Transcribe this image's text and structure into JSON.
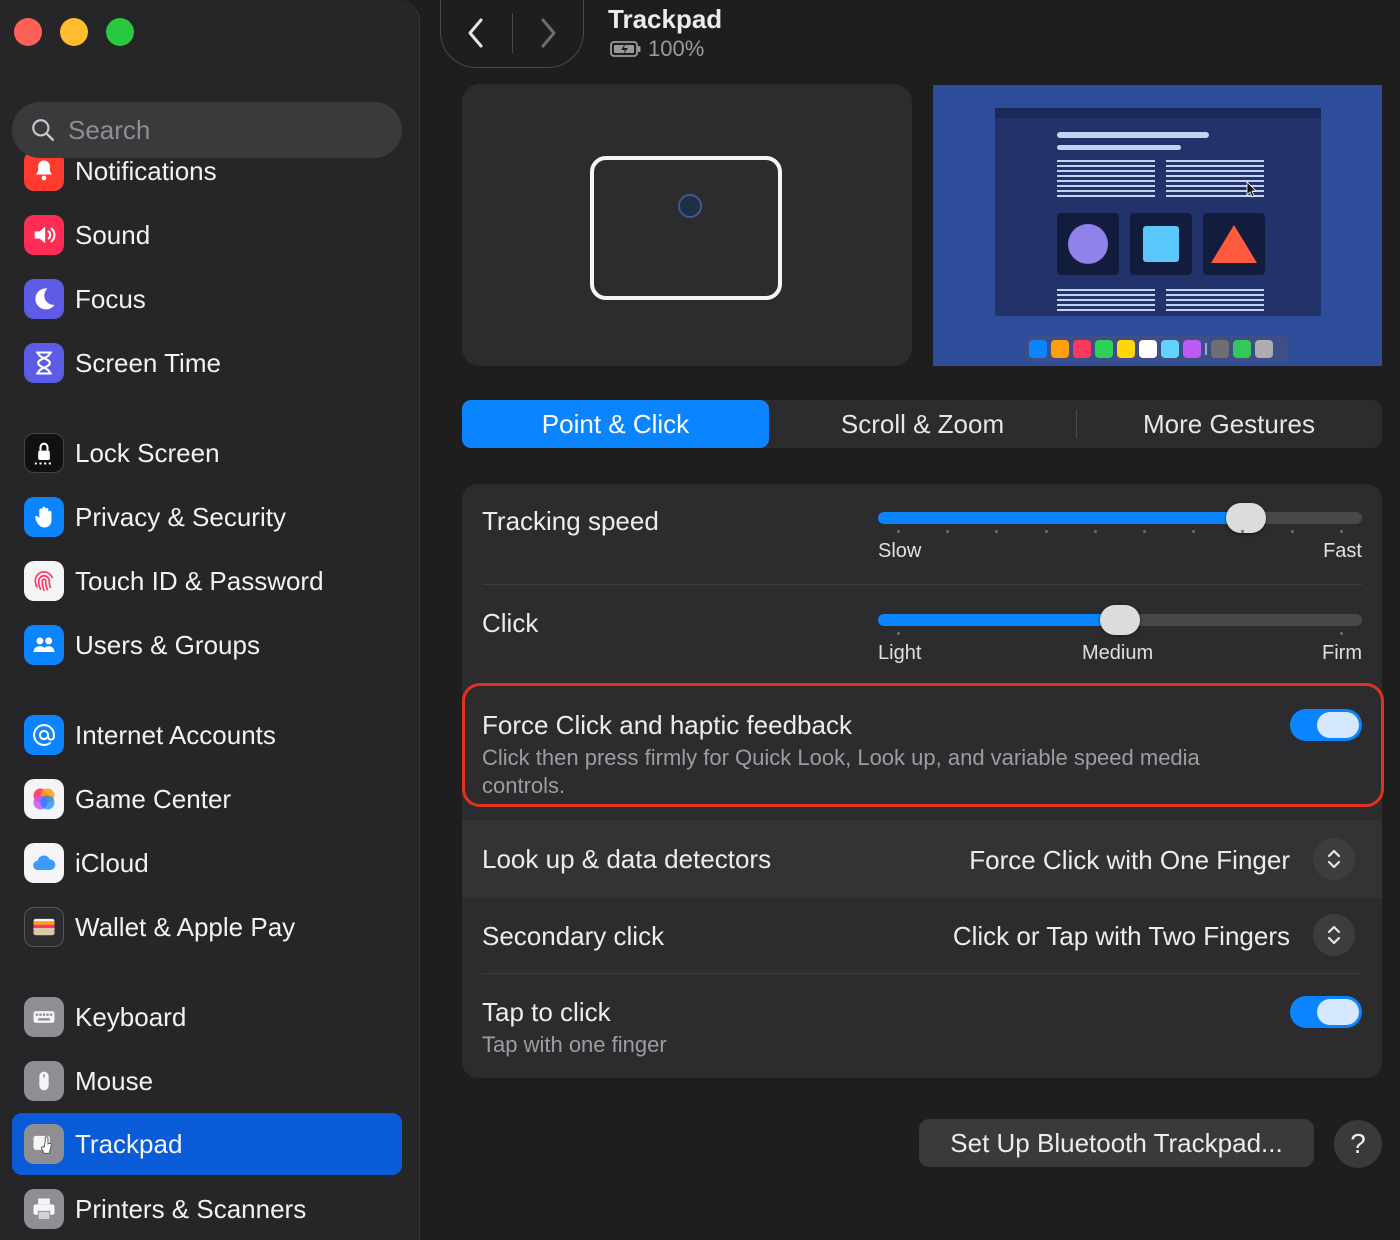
{
  "window": {
    "title": "Trackpad",
    "battery_text": "100%"
  },
  "sidebar": {
    "search_placeholder": "Search",
    "items": [
      {
        "label": "Notifications",
        "icon": "bell-icon",
        "color": "#ff3b30"
      },
      {
        "label": "Sound",
        "icon": "speaker-icon",
        "color": "#ff2d55"
      },
      {
        "label": "Focus",
        "icon": "moon-icon",
        "color": "#5e5ce6"
      },
      {
        "label": "Screen Time",
        "icon": "hourglass-icon",
        "color": "#5e5ce6"
      },
      {
        "label": "Lock Screen",
        "icon": "lock-icon",
        "color": "#1c1c1e"
      },
      {
        "label": "Privacy & Security",
        "icon": "hand-icon",
        "color": "#0a84ff"
      },
      {
        "label": "Touch ID & Password",
        "icon": "fingerprint-icon",
        "color": "#f5f5f7"
      },
      {
        "label": "Users & Groups",
        "icon": "users-icon",
        "color": "#0a84ff"
      },
      {
        "label": "Internet Accounts",
        "icon": "at-icon",
        "color": "#0a84ff"
      },
      {
        "label": "Game Center",
        "icon": "game-center-icon",
        "color": "#f5f5f7"
      },
      {
        "label": "iCloud",
        "icon": "cloud-icon",
        "color": "#f5f5f7"
      },
      {
        "label": "Wallet & Apple Pay",
        "icon": "wallet-icon",
        "color": "#2c2c2e"
      },
      {
        "label": "Keyboard",
        "icon": "keyboard-icon",
        "color": "#8e8e93"
      },
      {
        "label": "Mouse",
        "icon": "mouse-icon",
        "color": "#8e8e93"
      },
      {
        "label": "Trackpad",
        "icon": "trackpad-icon",
        "color": "#8e8e93",
        "selected": true
      },
      {
        "label": "Printers & Scanners",
        "icon": "printer-icon",
        "color": "#8e8e93"
      }
    ]
  },
  "tabs": [
    {
      "label": "Point & Click",
      "active": true
    },
    {
      "label": "Scroll & Zoom",
      "active": false
    },
    {
      "label": "More Gestures",
      "active": false
    }
  ],
  "settings": {
    "tracking_speed": {
      "label": "Tracking speed",
      "min_label": "Slow",
      "max_label": "Fast",
      "value_fraction": 0.76
    },
    "click": {
      "label": "Click",
      "labels": [
        "Light",
        "Medium",
        "Firm"
      ],
      "value": "Medium"
    },
    "force_click": {
      "label": "Force Click and haptic feedback",
      "description": "Click then press firmly for Quick Look, Look up, and variable speed media controls.",
      "enabled": true
    },
    "lookup": {
      "label": "Look up & data detectors",
      "value": "Force Click with One Finger"
    },
    "secondary_click": {
      "label": "Secondary click",
      "value": "Click or Tap with Two Fingers"
    },
    "tap_to_click": {
      "label": "Tap to click",
      "description": "Tap with one finger",
      "enabled": true
    }
  },
  "buttons": {
    "setup": "Set Up Bluetooth Trackpad...",
    "help": "?"
  },
  "colors": {
    "accent": "#0a84ff",
    "highlight": "#e0321f",
    "selected_sidebar": "#0a5bd8"
  }
}
